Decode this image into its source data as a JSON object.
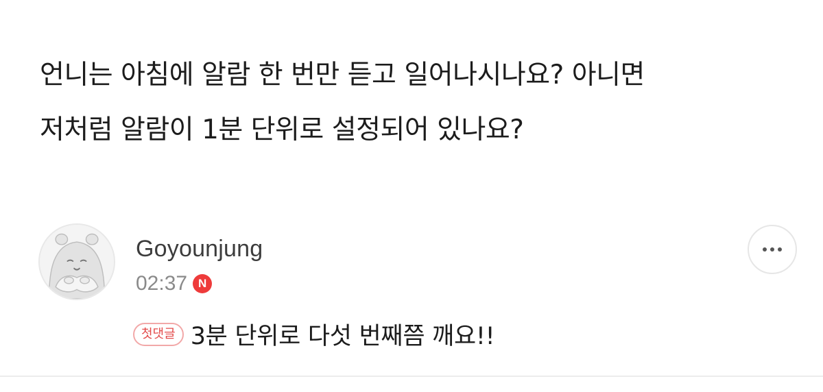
{
  "post": {
    "question_line1": "언니는 아침에 알람 한 번만 듣고 일어나시나요? 아니면",
    "question_line2": "저처럼 알람이 1분 단위로 설정되어 있나요?"
  },
  "comment": {
    "username": "Goyounjung",
    "time": "02:37",
    "new_badge": "N",
    "first_comment_tag": "첫댓글",
    "text": "3분 단위로 다섯 번째쯤 깨요!!",
    "more_icon": "more-horizontal-icon"
  },
  "colors": {
    "badge_red": "#ee3b3b",
    "tag_border": "#f2a8a8",
    "tag_text": "#e34b4b",
    "meta_gray": "#8a8a8a"
  }
}
